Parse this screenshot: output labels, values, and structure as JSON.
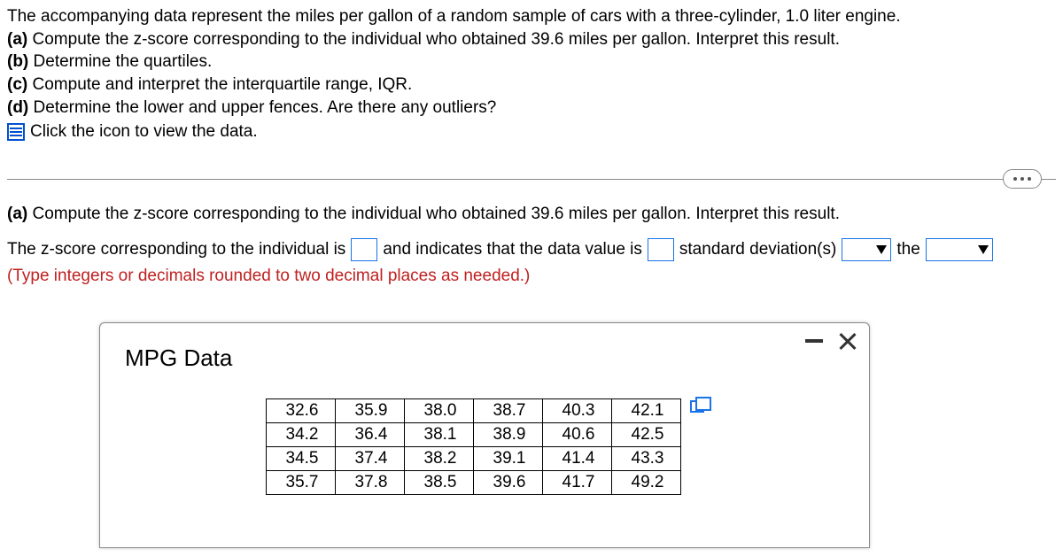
{
  "intro": "The accompanying data represent the miles per gallon of a random sample of cars with a three-cylinder, 1.0 liter engine.",
  "parts": {
    "a": {
      "label": "(a)",
      "text": "Compute the z-score corresponding to the individual who obtained 39.6 miles per gallon. Interpret this result."
    },
    "b": {
      "label": "(b)",
      "text": "Determine the quartiles."
    },
    "c": {
      "label": "(c)",
      "text": "Compute and interpret the interquartile range, IQR."
    },
    "d": {
      "label": "(d)",
      "text": "Determine the lower and upper fences. Are there any outliers?"
    }
  },
  "click_hint": "Click the icon to view the data.",
  "part_a_heading": {
    "label": "(a)",
    "text": "Compute the z-score corresponding to the individual who obtained 39.6 miles per gallon. Interpret this result."
  },
  "answer": {
    "seg1": "The z-score corresponding to the individual is",
    "seg2": "and indicates that the data value is",
    "seg3": "standard deviation(s)",
    "seg4": "the",
    "dropdown1_label": "",
    "dropdown2_label": ""
  },
  "hint": "(Type integers or decimals rounded to two decimal places as needed.)",
  "modal": {
    "title": "MPG Data",
    "rows": [
      [
        "32.6",
        "35.9",
        "38.0",
        "38.7",
        "40.3",
        "42.1"
      ],
      [
        "34.2",
        "36.4",
        "38.1",
        "38.9",
        "40.6",
        "42.5"
      ],
      [
        "34.5",
        "37.4",
        "38.2",
        "39.1",
        "41.4",
        "43.3"
      ],
      [
        "35.7",
        "37.8",
        "38.5",
        "39.6",
        "41.7",
        "49.2"
      ]
    ]
  },
  "chart_data": {
    "type": "table",
    "title": "MPG Data",
    "values": [
      [
        32.6,
        35.9,
        38.0,
        38.7,
        40.3,
        42.1
      ],
      [
        34.2,
        36.4,
        38.1,
        38.9,
        40.6,
        42.5
      ],
      [
        34.5,
        37.4,
        38.2,
        39.1,
        41.4,
        43.3
      ],
      [
        35.7,
        37.8,
        38.5,
        39.6,
        41.7,
        49.2
      ]
    ]
  }
}
